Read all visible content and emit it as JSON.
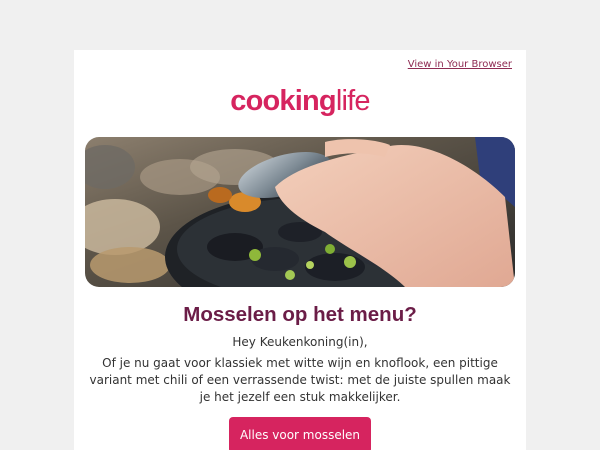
{
  "header": {
    "browser_link": "View in Your Browser"
  },
  "logo": {
    "part_bold": "cooking",
    "part_light": "life"
  },
  "main": {
    "title": "Mosselen op het menu?",
    "greeting": "Hey Keukenkoning(in),",
    "body": "Of je nu gaat voor klassiek met witte wijn en knoflook, een pittige variant met chili of een verrassende twist: met de juiste spullen maak je het jezelf een stuk makkelijker.",
    "cta_label": "Alles voor mosselen"
  },
  "colors": {
    "brand": "#d6245f",
    "title": "#6b1d47",
    "link": "#8e2a52"
  }
}
